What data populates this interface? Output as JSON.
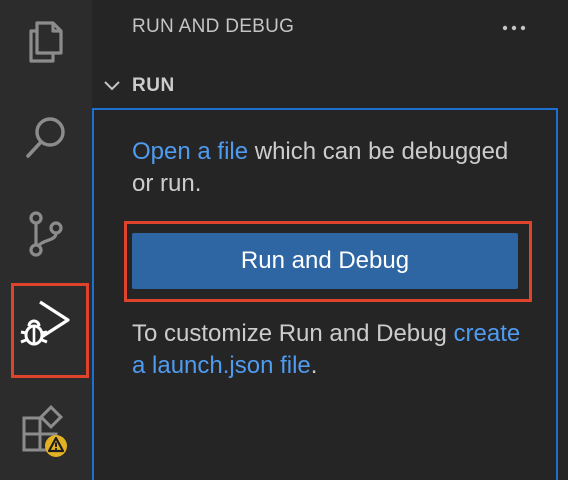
{
  "activity_bar": {
    "items": [
      {
        "name": "explorer",
        "icon": "files-icon"
      },
      {
        "name": "search",
        "icon": "search-icon"
      },
      {
        "name": "source-control",
        "icon": "source-control-icon"
      },
      {
        "name": "run-and-debug",
        "icon": "run-debug-icon",
        "active": true
      },
      {
        "name": "extensions",
        "icon": "extensions-icon",
        "badge": "warning"
      }
    ]
  },
  "sidebar": {
    "title": "RUN AND DEBUG",
    "more_icon": "ellipsis-icon",
    "section": {
      "title": "RUN",
      "chevron": "chevron-down-icon",
      "intro_link": "Open a file",
      "intro_text": " which can be debugged or run.",
      "button_label": "Run and Debug",
      "customize_text": "To customize Run and Debug ",
      "customize_link": "create a launch.json file",
      "customize_end": "."
    }
  },
  "colors": {
    "activity_bar_bg": "#2c2c2c",
    "sidebar_bg": "#252526",
    "link": "#4f9bf0",
    "button_bg": "#2e65a3",
    "focus_border": "#1f6fd0",
    "highlight": "#e0432b",
    "warning_badge": "#e2b224"
  }
}
